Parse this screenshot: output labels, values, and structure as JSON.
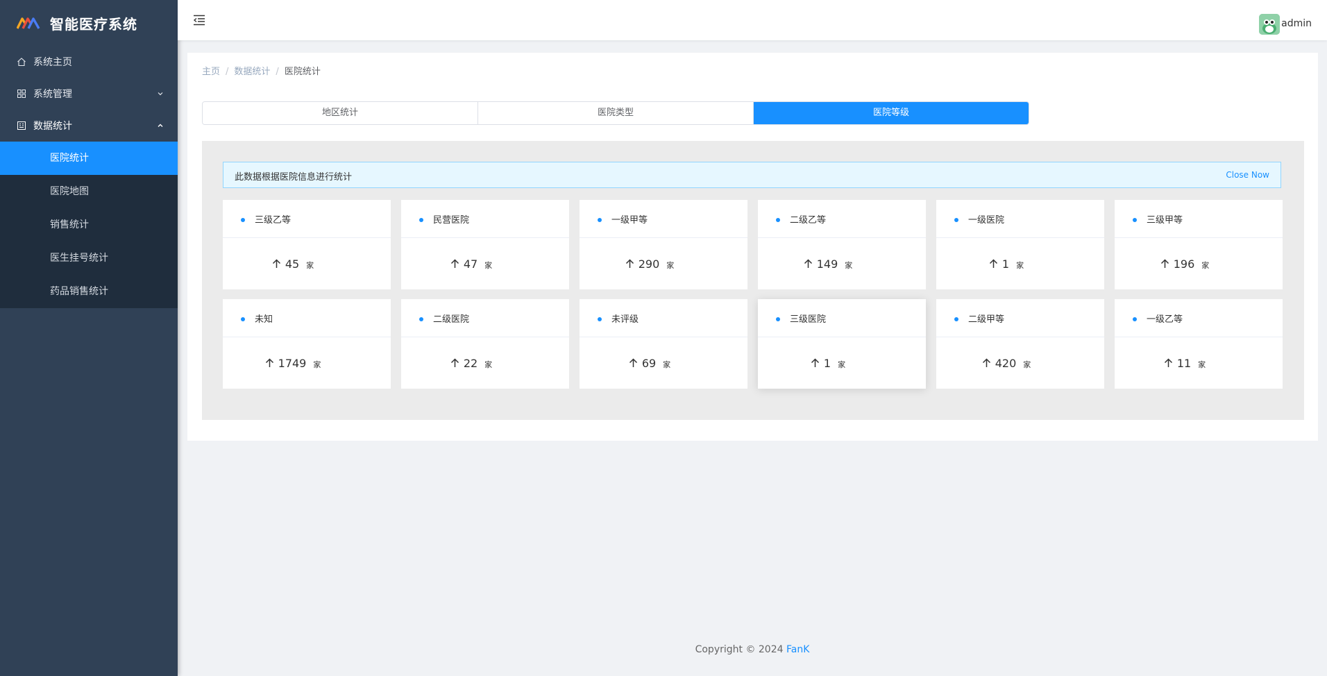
{
  "app": {
    "title": "智能医疗系统"
  },
  "sidebar": {
    "items": [
      {
        "label": "系统主页",
        "icon": "home-icon"
      },
      {
        "label": "系统管理",
        "icon": "grid-icon"
      },
      {
        "label": "数据统计",
        "icon": "stats-icon"
      }
    ],
    "submenu": [
      "医院统计",
      "医院地图",
      "销售统计",
      "医生挂号统计",
      "药品销售统计"
    ],
    "active_sub": "医院统计"
  },
  "header": {
    "username": "admin"
  },
  "breadcrumb": [
    "主页",
    "数据统计",
    "医院统计"
  ],
  "tabs": [
    "地区统计",
    "医院类型",
    "医院等级"
  ],
  "active_tab": "医院等级",
  "alert": {
    "text": "此数据根据医院信息进行统计",
    "close_label": "Close Now"
  },
  "cards": [
    {
      "name": "三级乙等",
      "value": "45",
      "unit": "家"
    },
    {
      "name": "民营医院",
      "value": "47",
      "unit": "家"
    },
    {
      "name": "一级甲等",
      "value": "290",
      "unit": "家"
    },
    {
      "name": "二级乙等",
      "value": "149",
      "unit": "家"
    },
    {
      "name": "一级医院",
      "value": "1",
      "unit": "家"
    },
    {
      "name": "三级甲等",
      "value": "196",
      "unit": "家"
    },
    {
      "name": "未知",
      "value": "1749",
      "unit": "家"
    },
    {
      "name": "二级医院",
      "value": "22",
      "unit": "家"
    },
    {
      "name": "未评级",
      "value": "69",
      "unit": "家"
    },
    {
      "name": "三级医院",
      "value": "1",
      "unit": "家"
    },
    {
      "name": "二级甲等",
      "value": "420",
      "unit": "家"
    },
    {
      "name": "一级乙等",
      "value": "11",
      "unit": "家"
    }
  ],
  "footer": {
    "copyright": "Copyright © 2024",
    "author": "FanK"
  },
  "colors": {
    "accent": "#1890ff",
    "sidebar_bg": "#304156",
    "submenu_bg": "#1f2d3d"
  }
}
